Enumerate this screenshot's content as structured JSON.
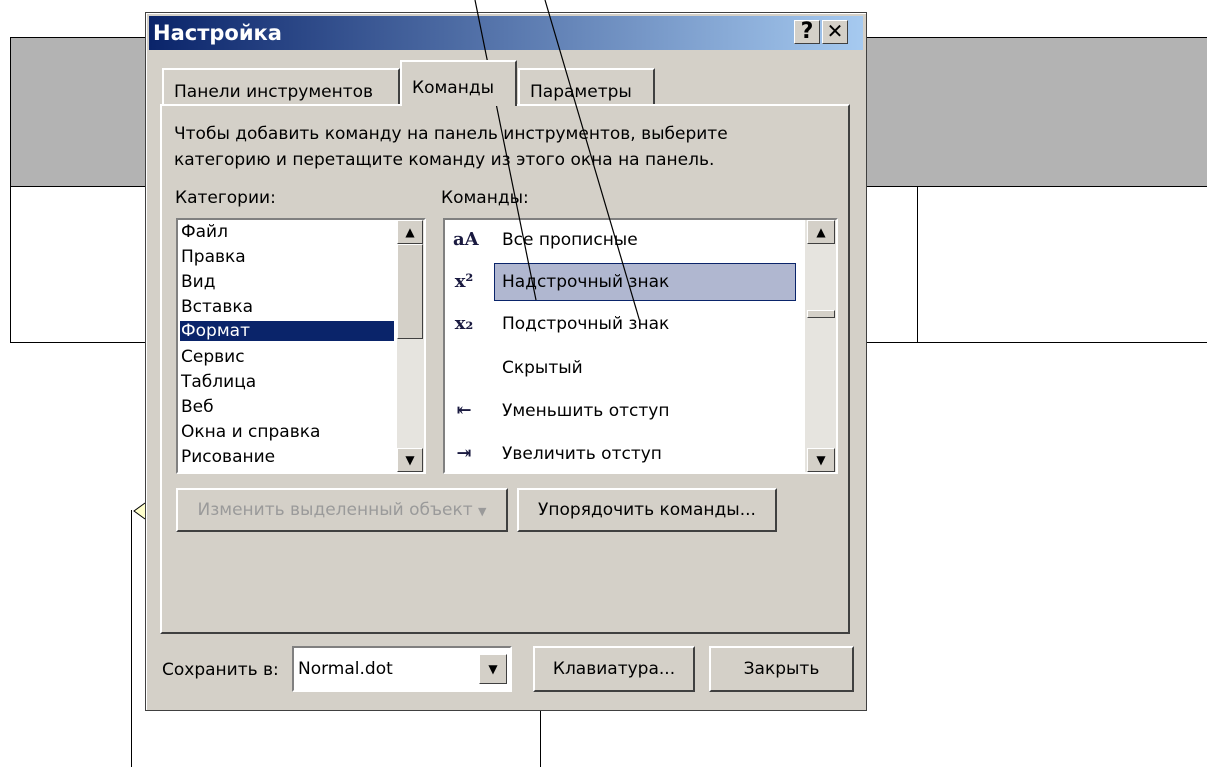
{
  "dialog": {
    "title": "Настройка",
    "help_button": "?",
    "close_button": "✕"
  },
  "tabs": [
    {
      "label": "Панели инструментов"
    },
    {
      "label": "Команды"
    },
    {
      "label": "Параметры"
    }
  ],
  "description": {
    "line1": "Чтобы добавить команду на панель инструментов, выберите",
    "line2": "категорию и перетащите команду из этого окна на панель."
  },
  "categories": {
    "label": "Категории:",
    "selected": "Формат",
    "items": [
      "Файл",
      "Правка",
      "Вид",
      "Вставка",
      "Формат",
      "Сервис",
      "Таблица",
      "Веб",
      "Окна и справка",
      "Рисование"
    ]
  },
  "commands": {
    "label": "Команды:",
    "selected": "Надстрочный знак",
    "items": [
      {
        "label": "Все прописные",
        "icon": "all-caps-icon"
      },
      {
        "label": "Надстрочный знак",
        "icon": "superscript-icon"
      },
      {
        "label": "Подстрочный знак",
        "icon": "subscript-icon"
      },
      {
        "label": "Скрытый",
        "icon": ""
      },
      {
        "label": "Уменьшить отступ",
        "icon": "decrease-indent-icon"
      },
      {
        "label": "Увеличить отступ",
        "icon": "increase-indent-icon"
      }
    ]
  },
  "buttons": {
    "modify_selection": "Изменить выделенный объект",
    "rearrange": "Упорядочить команды...",
    "keyboard": "Клавиатура...",
    "close": "Закрыть"
  },
  "save_in": {
    "label": "Сохранить в:",
    "value": "Normal.dot"
  },
  "colors": {
    "title_start": "#0a246a",
    "title_end": "#a6caf0",
    "selection": "#0a246a",
    "dialog_face": "#d4d0c8"
  }
}
